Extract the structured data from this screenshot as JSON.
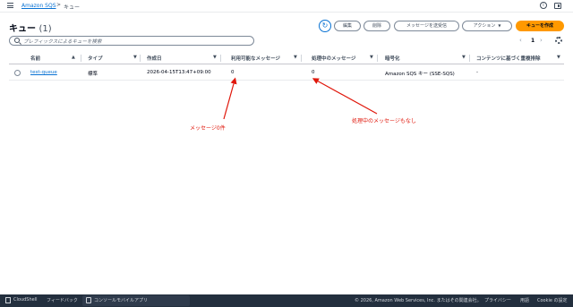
{
  "breadcrumb": {
    "service": "Amazon SQS",
    "separator": ">",
    "current": "キュー"
  },
  "header": {
    "title": "キュー",
    "count": "(1)"
  },
  "toolbar": {
    "edit": "編集",
    "delete": "削除",
    "send_receive": "メッセージを送受信",
    "actions": "アクション",
    "create": "キューを作成"
  },
  "search": {
    "placeholder": "プレフィックスによるキューを検索"
  },
  "pagination": {
    "page": "1"
  },
  "table": {
    "columns": [
      "名前",
      "タイプ",
      "作成日",
      "利用可能なメッセージ",
      "処理中のメッセージ",
      "暗号化",
      "コンテンツに基づく重複排除"
    ],
    "rows": [
      {
        "name": "test-queue",
        "type": "標準",
        "created": "2026-04-15T13:47+09:00",
        "available": "0",
        "in_flight": "0",
        "encryption": "Amazon SQS キー (SSE-SQS)",
        "dedup": "-"
      }
    ]
  },
  "annotations": {
    "available_note": "メッセージ0件",
    "in_flight_note": "処理中のメッセージもなし",
    "color": "#e0170b"
  },
  "footer": {
    "cloudshell": "CloudShell",
    "feedback": "フィードバック",
    "mobile_app": "コンソールモバイルアプリ",
    "copyright": "© 2026, Amazon Web Services, Inc. またはその関連会社。",
    "privacy": "プライバシー",
    "terms": "用語",
    "cookies": "Cookie の設定"
  },
  "colors": {
    "accent": "#0972d3",
    "primary_button": "#ff9900",
    "footer_bg": "#232f3e"
  }
}
